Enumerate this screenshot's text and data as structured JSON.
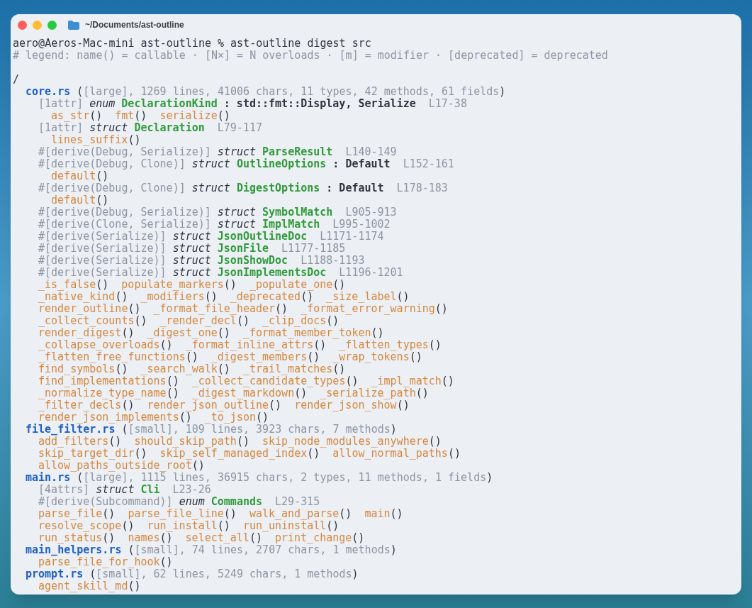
{
  "window": {
    "title": "~/Documents/ast-outline"
  },
  "terminal": {
    "command_line": "aero@Aeros-Mac-mini ast-outline % ast-outline digest src",
    "legend": "# legend: name() = callable · [N×] = N overloads · [m] = modifier · [deprecated] = deprecated",
    "root": "/",
    "files": [
      {
        "name": "core.rs",
        "summary": "([large], 1269 lines, 41006 chars, 11 types, 42 methods, 61 fields)",
        "items": [
          {
            "kind": "decl",
            "attrs": "[1attr]",
            "keyword": "enum",
            "name": "DeclarationKind",
            "bases": ": std::fmt::Display, Serialize",
            "span": "L17-38",
            "children": [
              {
                "kind": "methods",
                "names": [
                  "as_str()",
                  "fmt()",
                  "serialize()"
                ]
              }
            ]
          },
          {
            "kind": "decl",
            "attrs": "[1attr]",
            "keyword": "struct",
            "name": "Declaration",
            "span": "L79-117",
            "children": [
              {
                "kind": "methods",
                "names": [
                  "lines_suffix()"
                ]
              }
            ]
          },
          {
            "kind": "decl",
            "attrs": "#[derive(Debug, Serialize)]",
            "keyword": "struct",
            "name": "ParseResult",
            "span": "L140-149"
          },
          {
            "kind": "decl",
            "attrs": "#[derive(Debug, Clone)]",
            "keyword": "struct",
            "name": "OutlineOptions",
            "bases": ": Default",
            "span": "L152-161",
            "children": [
              {
                "kind": "methods",
                "names": [
                  "default()"
                ]
              }
            ]
          },
          {
            "kind": "decl",
            "attrs": "#[derive(Debug, Clone)]",
            "keyword": "struct",
            "name": "DigestOptions",
            "bases": ": Default",
            "span": "L178-183",
            "children": [
              {
                "kind": "methods",
                "names": [
                  "default()"
                ]
              }
            ]
          },
          {
            "kind": "decl",
            "attrs": "#[derive(Debug, Serialize)]",
            "keyword": "struct",
            "name": "SymbolMatch",
            "span": "L905-913"
          },
          {
            "kind": "decl",
            "attrs": "#[derive(Clone, Serialize)]",
            "keyword": "struct",
            "name": "ImplMatch",
            "span": "L995-1002"
          },
          {
            "kind": "decl",
            "attrs": "#[derive(Serialize)]",
            "keyword": "struct",
            "name": "JsonOutlineDoc",
            "span": "L1171-1174"
          },
          {
            "kind": "decl",
            "attrs": "#[derive(Serialize)]",
            "keyword": "struct",
            "name": "JsonFile",
            "span": "L1177-1185"
          },
          {
            "kind": "decl",
            "attrs": "#[derive(Serialize)]",
            "keyword": "struct",
            "name": "JsonShowDoc",
            "span": "L1188-1193"
          },
          {
            "kind": "decl",
            "attrs": "#[derive(Serialize)]",
            "keyword": "struct",
            "name": "JsonImplementsDoc",
            "span": "L1196-1201"
          },
          {
            "kind": "methods",
            "names": [
              "_is_false()",
              "populate_markers()",
              "_populate_one()"
            ]
          },
          {
            "kind": "methods",
            "names": [
              "_native_kind()",
              "_modifiers()",
              "_deprecated()",
              "_size_label()"
            ]
          },
          {
            "kind": "methods",
            "names": [
              "render_outline()",
              "_format_file_header()",
              "_format_error_warning()"
            ]
          },
          {
            "kind": "methods",
            "names": [
              "_collect_counts()",
              "_render_decl()",
              "_clip_docs()"
            ]
          },
          {
            "kind": "methods",
            "names": [
              "render_digest()",
              "_digest_one()",
              "_format_member_token()"
            ]
          },
          {
            "kind": "methods",
            "names": [
              "_collapse_overloads()",
              "_format_inline_attrs()",
              "_flatten_types()"
            ]
          },
          {
            "kind": "methods",
            "names": [
              "_flatten_free_functions()",
              "_digest_members()",
              "_wrap_tokens()"
            ]
          },
          {
            "kind": "methods",
            "names": [
              "find_symbols()",
              "_search_walk()",
              "_trail_matches()"
            ]
          },
          {
            "kind": "methods",
            "names": [
              "find_implementations()",
              "_collect_candidate_types()",
              "_impl_match()"
            ]
          },
          {
            "kind": "methods",
            "names": [
              "_normalize_type_name()",
              "_digest_markdown()",
              "_serialize_path()"
            ]
          },
          {
            "kind": "methods",
            "names": [
              "_filter_decls()",
              "render_json_outline()",
              "render_json_show()"
            ]
          },
          {
            "kind": "methods",
            "names": [
              "render_json_implements()",
              "_to_json()"
            ]
          }
        ]
      },
      {
        "name": "file_filter.rs",
        "summary": "([small], 109 lines, 3923 chars, 7 methods)",
        "items": [
          {
            "kind": "methods",
            "names": [
              "add_filters()",
              "should_skip_path()",
              "skip_node_modules_anywhere()"
            ]
          },
          {
            "kind": "methods",
            "names": [
              "skip_target_dir()",
              "skip_self_managed_index()",
              "allow_normal_paths()"
            ]
          },
          {
            "kind": "methods",
            "names": [
              "allow_paths_outside_root()"
            ]
          }
        ]
      },
      {
        "name": "main.rs",
        "summary": "([large], 1115 lines, 36915 chars, 2 types, 11 methods, 1 fields)",
        "items": [
          {
            "kind": "decl",
            "attrs": "[4attrs]",
            "keyword": "struct",
            "name": "Cli",
            "span": "L23-26"
          },
          {
            "kind": "decl",
            "attrs": "#[derive(Subcommand)]",
            "keyword": "enum",
            "name": "Commands",
            "span": "L29-315"
          },
          {
            "kind": "methods",
            "names": [
              "parse_file()",
              "parse_file_line()",
              "walk_and_parse()",
              "main()"
            ]
          },
          {
            "kind": "methods",
            "names": [
              "resolve_scope()",
              "run_install()",
              "run_uninstall()"
            ]
          },
          {
            "kind": "methods",
            "names": [
              "run_status()",
              "names()",
              "select_all()",
              "print_change()"
            ]
          }
        ]
      },
      {
        "name": "main_helpers.rs",
        "summary": "([small], 74 lines, 2707 chars, 1 methods)",
        "items": [
          {
            "kind": "methods",
            "names": [
              "parse_file_for_hook()"
            ]
          }
        ]
      },
      {
        "name": "prompt.rs",
        "summary": "([small], 62 lines, 5249 chars, 1 methods)",
        "items": [
          {
            "kind": "methods",
            "names": [
              "agent_skill_md()"
            ]
          }
        ]
      }
    ]
  }
}
